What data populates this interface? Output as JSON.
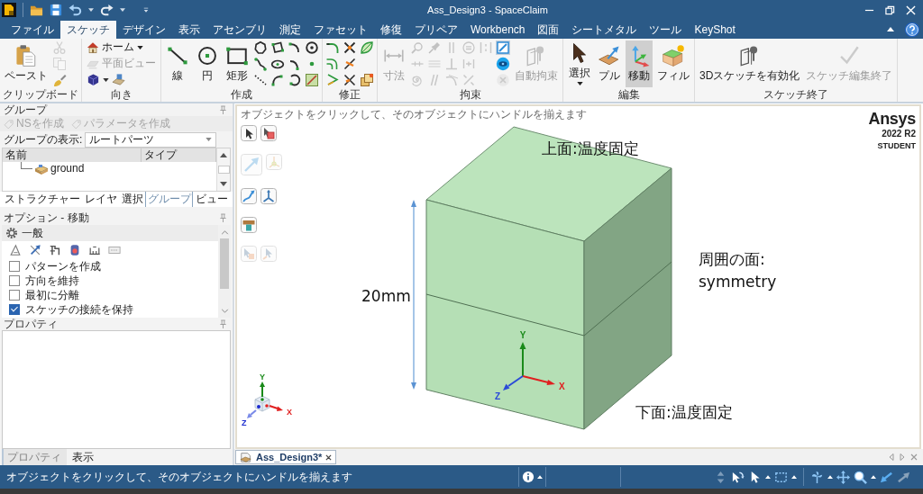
{
  "window": {
    "title": "Ass_Design3 - SpaceClaim"
  },
  "ribbon": {
    "tabs": [
      {
        "label": "ファイル",
        "selected": false
      },
      {
        "label": "スケッチ",
        "selected": true
      },
      {
        "label": "デザイン",
        "selected": false
      },
      {
        "label": "表示",
        "selected": false
      },
      {
        "label": "アセンブリ",
        "selected": false
      },
      {
        "label": "測定",
        "selected": false
      },
      {
        "label": "ファセット",
        "selected": false
      },
      {
        "label": "修復",
        "selected": false
      },
      {
        "label": "プリペア",
        "selected": false
      },
      {
        "label": "Workbench",
        "selected": false
      },
      {
        "label": "図面",
        "selected": false
      },
      {
        "label": "シートメタル",
        "selected": false
      },
      {
        "label": "ツール",
        "selected": false
      },
      {
        "label": "KeyShot",
        "selected": false
      }
    ],
    "groups": [
      {
        "label": "クリップボード",
        "columns": [
          {
            "kind": "large",
            "label": "ペースト",
            "disabled": false
          },
          {
            "kind": "stack",
            "items": [
              {
                "disabled": true
              },
              {
                "disabled": true
              },
              {
                "disabled": false
              }
            ]
          }
        ]
      },
      {
        "label": "向き",
        "columns": [
          {
            "kind": "stack",
            "items": [
              {
                "kind": "menu",
                "label": "ホーム",
                "disabled": false
              },
              {
                "kind": "labeled",
                "label": "平面ビュー",
                "disabled": true
              },
              {
                "kind": "icon-pair",
                "disabled": false
              }
            ]
          }
        ]
      },
      {
        "label": "作成",
        "columns": [
          {
            "kind": "large",
            "label": "線",
            "disabled": false
          },
          {
            "kind": "large",
            "label": "円",
            "disabled": false
          },
          {
            "kind": "large",
            "label": "矩形",
            "disabled": false
          },
          {
            "kind": "stack",
            "items": [
              {
                "disabled": false
              },
              {
                "disabled": false
              },
              {
                "disabled": false
              }
            ]
          },
          {
            "kind": "stack",
            "items": [
              {
                "disabled": false
              },
              {
                "disabled": false
              },
              {
                "disabled": false
              }
            ]
          },
          {
            "kind": "stack",
            "items": [
              {
                "disabled": false
              },
              {
                "disabled": false
              },
              {
                "disabled": false
              }
            ]
          },
          {
            "kind": "stack",
            "items": [
              {
                "disabled": false
              },
              {
                "disabled": false
              },
              {
                "disabled": false
              }
            ]
          }
        ]
      },
      {
        "label": "修正",
        "columns": [
          {
            "kind": "stack",
            "items": [
              {
                "disabled": false
              },
              {
                "disabled": false
              },
              {
                "disabled": false
              }
            ]
          },
          {
            "kind": "stack",
            "items": [
              {
                "disabled": false
              },
              {
                "disabled": false
              },
              {
                "disabled": false
              }
            ]
          },
          {
            "kind": "stack",
            "items": [
              {
                "disabled": false
              },
              {
                "disabled": false
              }
            ]
          }
        ]
      },
      {
        "label": "拘束",
        "columns": [
          {
            "kind": "large",
            "label": "寸法",
            "disabled": true
          },
          {
            "kind": "stack",
            "items": [
              {
                "disabled": true
              },
              {
                "disabled": true
              },
              {
                "disabled": true
              }
            ]
          },
          {
            "kind": "stack",
            "items": [
              {
                "disabled": true
              },
              {
                "disabled": true
              },
              {
                "disabled": true
              }
            ]
          },
          {
            "kind": "stack",
            "items": [
              {
                "disabled": true
              },
              {
                "disabled": true
              },
              {
                "disabled": true
              }
            ]
          },
          {
            "kind": "stack",
            "items": [
              {
                "disabled": true
              },
              {
                "disabled": true
              },
              {
                "disabled": true
              }
            ]
          },
          {
            "kind": "stack",
            "items": [
              {
                "disabled": true
              }
            ]
          },
          {
            "kind": "stack",
            "items": [
              {
                "disabled": false,
                "on": true
              },
              {
                "disabled": false,
                "on": false
              },
              {
                "disabled": true,
                "on": false
              }
            ]
          },
          {
            "kind": "large",
            "label": "自動拘束",
            "disabled": true
          }
        ]
      },
      {
        "label": "編集",
        "columns": [
          {
            "kind": "large-menu",
            "label": "選択",
            "disabled": false,
            "selected": false
          },
          {
            "kind": "large",
            "label": "プル",
            "disabled": false,
            "selected": false
          },
          {
            "kind": "large",
            "label": "移動",
            "disabled": false,
            "selected": true
          },
          {
            "kind": "large",
            "label": "フィル",
            "disabled": false,
            "selected": false
          }
        ]
      },
      {
        "label": "スケッチ終了",
        "columns": [
          {
            "kind": "large",
            "label": "3Dスケッチを有効化",
            "disabled": false
          },
          {
            "kind": "large",
            "label": "スケッチ編集終了",
            "disabled": true
          }
        ]
      }
    ]
  },
  "group_panel": {
    "title": "グループ",
    "actions": [
      {
        "label": "NSを作成",
        "disabled": true
      },
      {
        "label": "パラメータを作成",
        "disabled": true
      }
    ],
    "display_label": "グループの表示:",
    "display_value": "ルートパーツ",
    "columns": [
      "名前",
      "タイプ"
    ],
    "tree": [
      {
        "name": "ground"
      }
    ]
  },
  "panel_tabs": [
    {
      "label": "ストラクチャー",
      "selected": false
    },
    {
      "label": "レイヤ",
      "selected": false
    },
    {
      "label": "選択",
      "selected": false
    },
    {
      "label": "グループ",
      "selected": true
    },
    {
      "label": "ビュー",
      "selected": false
    }
  ],
  "options_panel": {
    "title": "オプション - 移動",
    "section": "一般",
    "checkboxes": [
      {
        "label": "パターンを作成",
        "checked": false
      },
      {
        "label": "方向を維持",
        "checked": false
      },
      {
        "label": "最初に分離",
        "checked": false
      },
      {
        "label": "スケッチの接続を保持",
        "checked": true
      }
    ]
  },
  "properties_panel": {
    "title": "プロパティ"
  },
  "properties_tabs": [
    {
      "label": "プロパティ",
      "selected": true
    },
    {
      "label": "表示",
      "selected": false
    }
  ],
  "viewport": {
    "hint": "オブジェクトをクリックして、そのオブジェクトにハンドルを揃えます",
    "logo": {
      "brand": "Ansys",
      "version": "2022 R2",
      "edition": "STUDENT"
    },
    "tools": [
      [
        {
          "disabled": false
        },
        {
          "disabled": false
        }
      ],
      [
        {
          "disabled": true
        },
        {
          "disabled": true
        }
      ],
      [
        {
          "disabled": false
        },
        {
          "disabled": false
        }
      ],
      [
        {
          "disabled": false
        }
      ],
      [
        {
          "disabled": true
        },
        {
          "disabled": true
        }
      ]
    ],
    "labels": {
      "top": "上面:温度固定",
      "side": "周囲の面:\nsymmetry",
      "dimension": "20mm",
      "bottom": "下面:温度固定"
    },
    "model_axes": {
      "x": "X",
      "y": "Y",
      "z": "Z"
    },
    "view_axes": {
      "x": "X",
      "y": "Y",
      "z": "Z"
    }
  },
  "document_tabs": [
    {
      "label": "Ass_Design3*",
      "selected": true
    }
  ],
  "status_bar": {
    "message": "オブジェクトをクリックして、そのオブジェクトにハンドルを揃えます",
    "tools": [
      {
        "kind": "button",
        "disabled": true
      },
      {
        "kind": "button",
        "disabled": false
      },
      {
        "kind": "menu",
        "disabled": false
      },
      {
        "kind": "menu",
        "disabled": false
      },
      {
        "kind": "menu",
        "disabled": false
      },
      {
        "kind": "button",
        "disabled": false
      },
      {
        "kind": "menu",
        "disabled": false
      },
      {
        "kind": "button",
        "disabled": false
      },
      {
        "kind": "button",
        "disabled": true
      }
    ]
  }
}
